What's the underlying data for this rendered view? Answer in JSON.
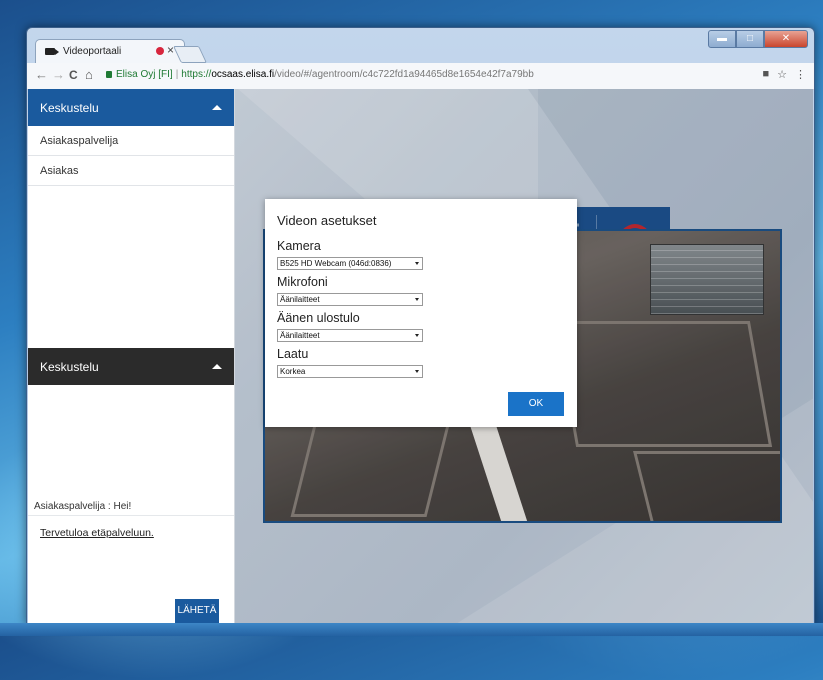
{
  "browser": {
    "tab_title": "Videoportaali",
    "tab_close": "×",
    "address": {
      "site_name": "Elisa Oyj [FI]",
      "scheme": "https://",
      "host": "ocsaas.elisa.fi",
      "path": "/video/#/agentroom/c4c722fd1a94465d8e1654e42f7a79bb"
    },
    "nav": {
      "back": "←",
      "forward": "→",
      "reload": "C",
      "home": "⌂"
    },
    "toolbar_right": {
      "camera": "■",
      "star": "☆",
      "menu": "⋮"
    },
    "window_controls": {
      "minimize": "▬",
      "maximize": "□",
      "close": "✕"
    }
  },
  "sidebar": {
    "header_top": "Keskustelu",
    "items": [
      {
        "label": "Asiakaspalvelija"
      },
      {
        "label": "Asiakas"
      }
    ],
    "header_chat": "Keskustelu",
    "chat_message": "Asiakaspalvelija : Hei!",
    "input_text": "Tervetuloa etäpalveluun.",
    "send_label": "LÄHETÄ"
  },
  "dialog": {
    "title": "Videon asetukset",
    "fields": [
      {
        "label": "Kamera",
        "value": "B525 HD Webcam (046d:0836)"
      },
      {
        "label": "Mikrofoni",
        "value": "Äänilaitteet"
      },
      {
        "label": "Äänen ulostulo",
        "value": "Äänilaitteet"
      },
      {
        "label": "Laatu",
        "value": "Korkea"
      }
    ],
    "ok_label": "OK"
  },
  "colors": {
    "accent": "#1a5a9e",
    "ok_button": "#1a73c8",
    "hangup": "#c0262d"
  }
}
